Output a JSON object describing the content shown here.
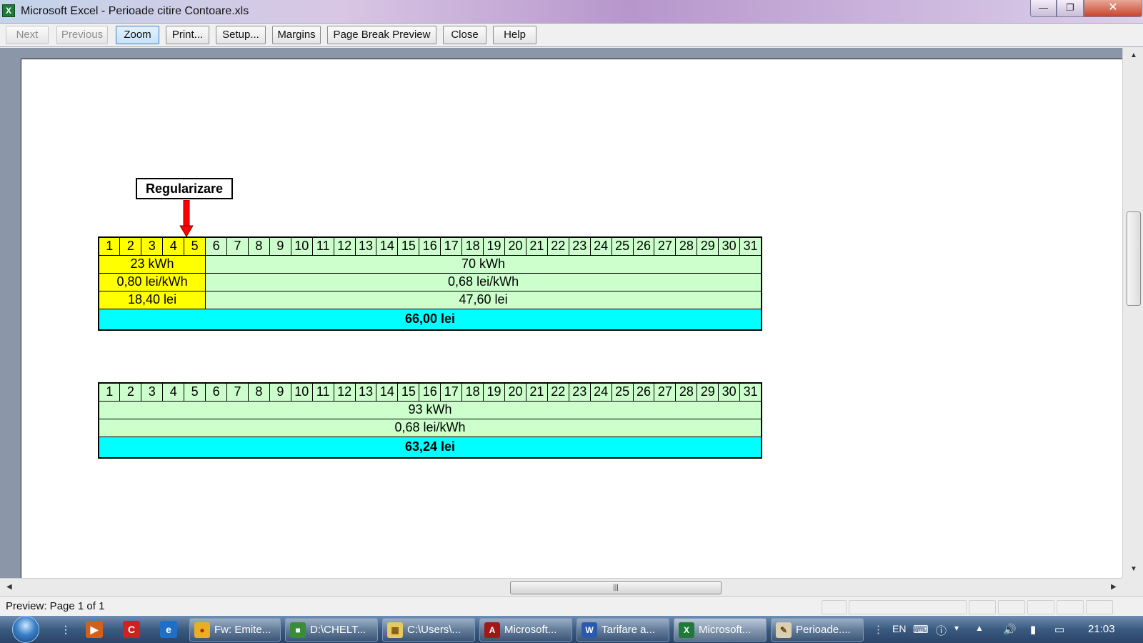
{
  "window": {
    "title": "Microsoft Excel - Perioade citire Contoare.xls",
    "app_icon": "excel-icon",
    "controls": {
      "minimize": "minimize-icon",
      "maximize": "restore-icon",
      "close": "close-icon"
    }
  },
  "toolbar": {
    "next": "Next",
    "previous": "Previous",
    "zoom": "Zoom",
    "print": "Print...",
    "setup": "Setup...",
    "margins": "Margins",
    "page_break_preview": "Page Break Preview",
    "close": "Close",
    "help": "Help"
  },
  "sheet": {
    "regularizare_label": "Regularizare",
    "days": [
      "1",
      "2",
      "3",
      "4",
      "5",
      "6",
      "7",
      "8",
      "9",
      "10",
      "11",
      "12",
      "13",
      "14",
      "15",
      "16",
      "17",
      "18",
      "19",
      "20",
      "21",
      "22",
      "23",
      "24",
      "25",
      "26",
      "27",
      "28",
      "29",
      "30",
      "31"
    ],
    "table1": {
      "period1": {
        "consumption": "23 kWh",
        "price": "0,80 lei/kWh",
        "cost": "18,40 lei"
      },
      "period2": {
        "consumption": "70 kWh",
        "price": "0,68 lei/kWh",
        "cost": "47,60 lei"
      },
      "total": "66,00 lei"
    },
    "table2": {
      "consumption": "93 kWh",
      "price": "0,68 lei/kWh",
      "total": "63,24 lei"
    },
    "colors": {
      "period1": "#ffff00",
      "period2": "#ccffcc",
      "total": "#00ffff",
      "arrow": "#ff0000"
    }
  },
  "status": {
    "text": "Preview: Page 1 of 1"
  },
  "taskbar": {
    "tasks": [
      {
        "label": "Fw: Emite...",
        "icon": "chrome-icon"
      },
      {
        "label": "D:\\CHELT...",
        "icon": "folder-program-icon"
      },
      {
        "label": "C:\\Users\\...",
        "icon": "folder-icon"
      },
      {
        "label": "Microsoft...",
        "icon": "access-icon"
      },
      {
        "label": "Tarifare a...",
        "icon": "word-icon"
      },
      {
        "label": "Microsoft...",
        "icon": "excel-icon"
      },
      {
        "label": "Perioade....",
        "icon": "paint-icon"
      }
    ],
    "language": "EN",
    "clock": "21:03"
  }
}
